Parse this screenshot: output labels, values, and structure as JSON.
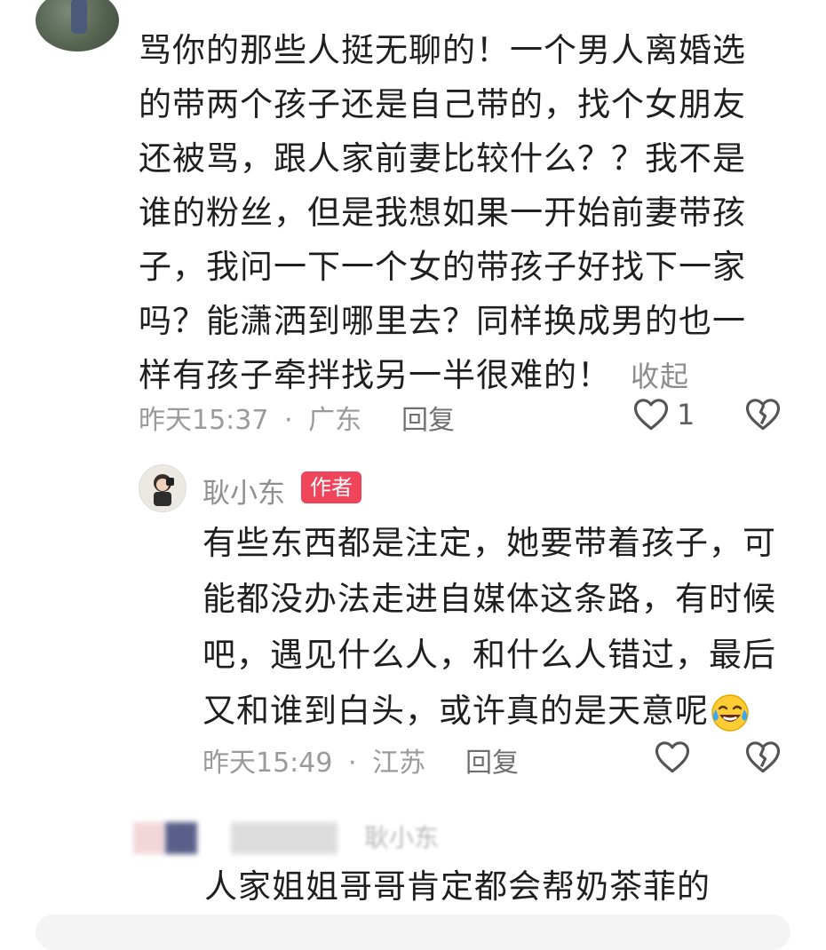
{
  "comment": {
    "text_lines": [
      "骂你的那些人挺无聊的！一个男人离婚选",
      "的带两个孩子还是自己带的，找个女朋友",
      "还被骂，跟人家前妻比较什么？？我不是",
      "谁的粉丝，但是我想如果一开始前妻带孩",
      "子，我问一下一个女的带孩子好找下一家",
      "吗？能潇洒到哪里去？同样换成男的也一",
      "样有孩子牵拌找另一半很难的！"
    ],
    "collapse_label": "收起",
    "time": "昨天15:37",
    "location": "广东",
    "separator": "·",
    "reply_label": "回复",
    "like_count": "1"
  },
  "reply": {
    "author": "耿小东",
    "badge": "作者",
    "text_lines": [
      "有些东西都是注定，她要带着孩子，可",
      "能都没办法走进自媒体这条路，有时候",
      "吧，遇见什么人，和什么人错过，最后",
      "又和谁到白头，或许真的是天意呢"
    ],
    "time": "昨天15:49",
    "location": "江苏",
    "separator": "·",
    "reply_label": "回复"
  },
  "third": {
    "blurred_author": "耿小东",
    "text": "人家姐姐哥哥肯定都会帮奶茶菲的"
  },
  "icons": {
    "like": "heart-outline-icon",
    "dislike": "broken-heart-icon",
    "emoji": "laughing-crying-emoji"
  },
  "colors": {
    "badge": "#f0445b",
    "meta": "#9a9a9a"
  }
}
